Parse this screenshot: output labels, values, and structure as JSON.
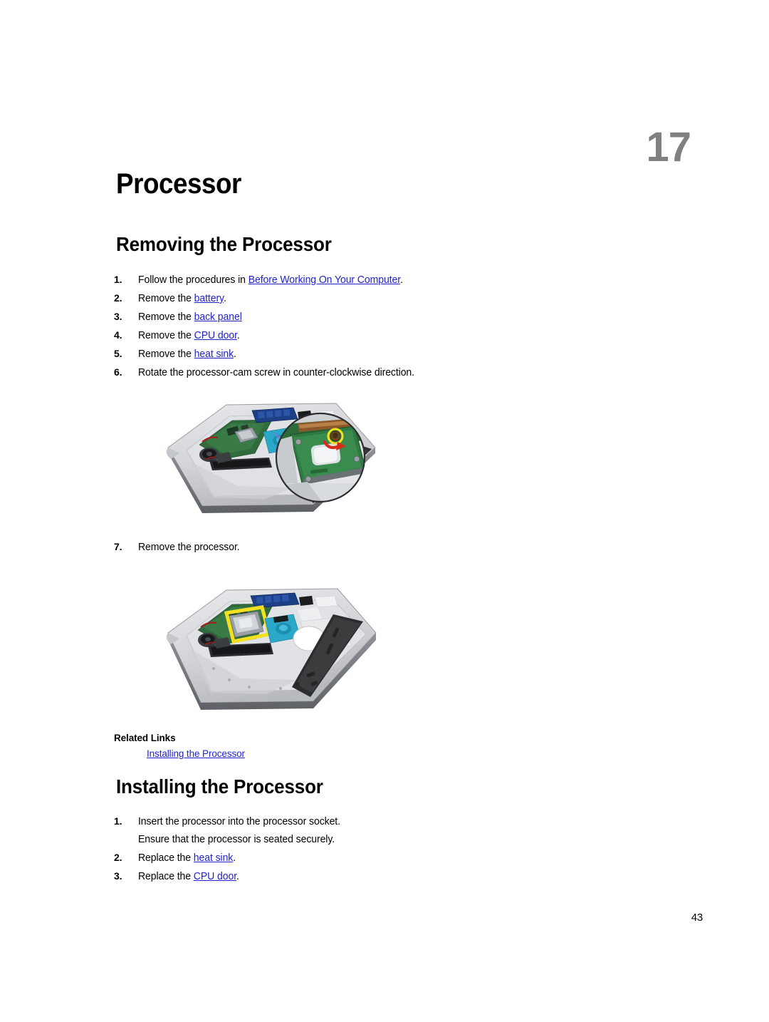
{
  "chapter": {
    "number": "17",
    "title": "Processor"
  },
  "sections": {
    "removing": {
      "heading": "Removing the Processor",
      "steps": [
        {
          "num": "1.",
          "before": "Follow the procedures in ",
          "link": "Before Working On Your Computer",
          "after": "."
        },
        {
          "num": "2.",
          "before": "Remove the ",
          "link": "battery",
          "after": "."
        },
        {
          "num": "3.",
          "before": "Remove the ",
          "link": "back panel",
          "after": ""
        },
        {
          "num": "4.",
          "before": "Remove the ",
          "link": "CPU door",
          "after": "."
        },
        {
          "num": "5.",
          "before": "Remove the ",
          "link": "heat sink",
          "after": "."
        },
        {
          "num": "6.",
          "before": "Rotate the processor-cam screw in counter-clockwise direction.",
          "link": "",
          "after": ""
        },
        {
          "num": "7.",
          "before": "Remove the processor.",
          "link": "",
          "after": ""
        }
      ]
    },
    "installing": {
      "heading": "Installing the Processor",
      "steps": [
        {
          "num": "1.",
          "before": "Insert the processor into the processor socket.",
          "link": "",
          "after": "",
          "sub": "Ensure that the processor is seated securely."
        },
        {
          "num": "2.",
          "before": "Replace the ",
          "link": "heat sink",
          "after": "."
        },
        {
          "num": "3.",
          "before": "Replace the ",
          "link": "CPU door",
          "after": "."
        }
      ]
    }
  },
  "related_links": {
    "title": "Related Links",
    "items": [
      "Installing the Processor"
    ]
  },
  "figures": [
    {
      "name": "laptop-cam-screw-photo",
      "caption": "",
      "callout": "magnified-processor-cam-screw"
    },
    {
      "name": "laptop-processor-socket-photo",
      "caption": "",
      "callout": "highlighted-processor-socket"
    }
  ],
  "page_number": "43",
  "colors": {
    "link": "#2222cc",
    "chapter_number": "#808080",
    "highlight": "#f5e020",
    "arrow": "#d42b1a"
  }
}
